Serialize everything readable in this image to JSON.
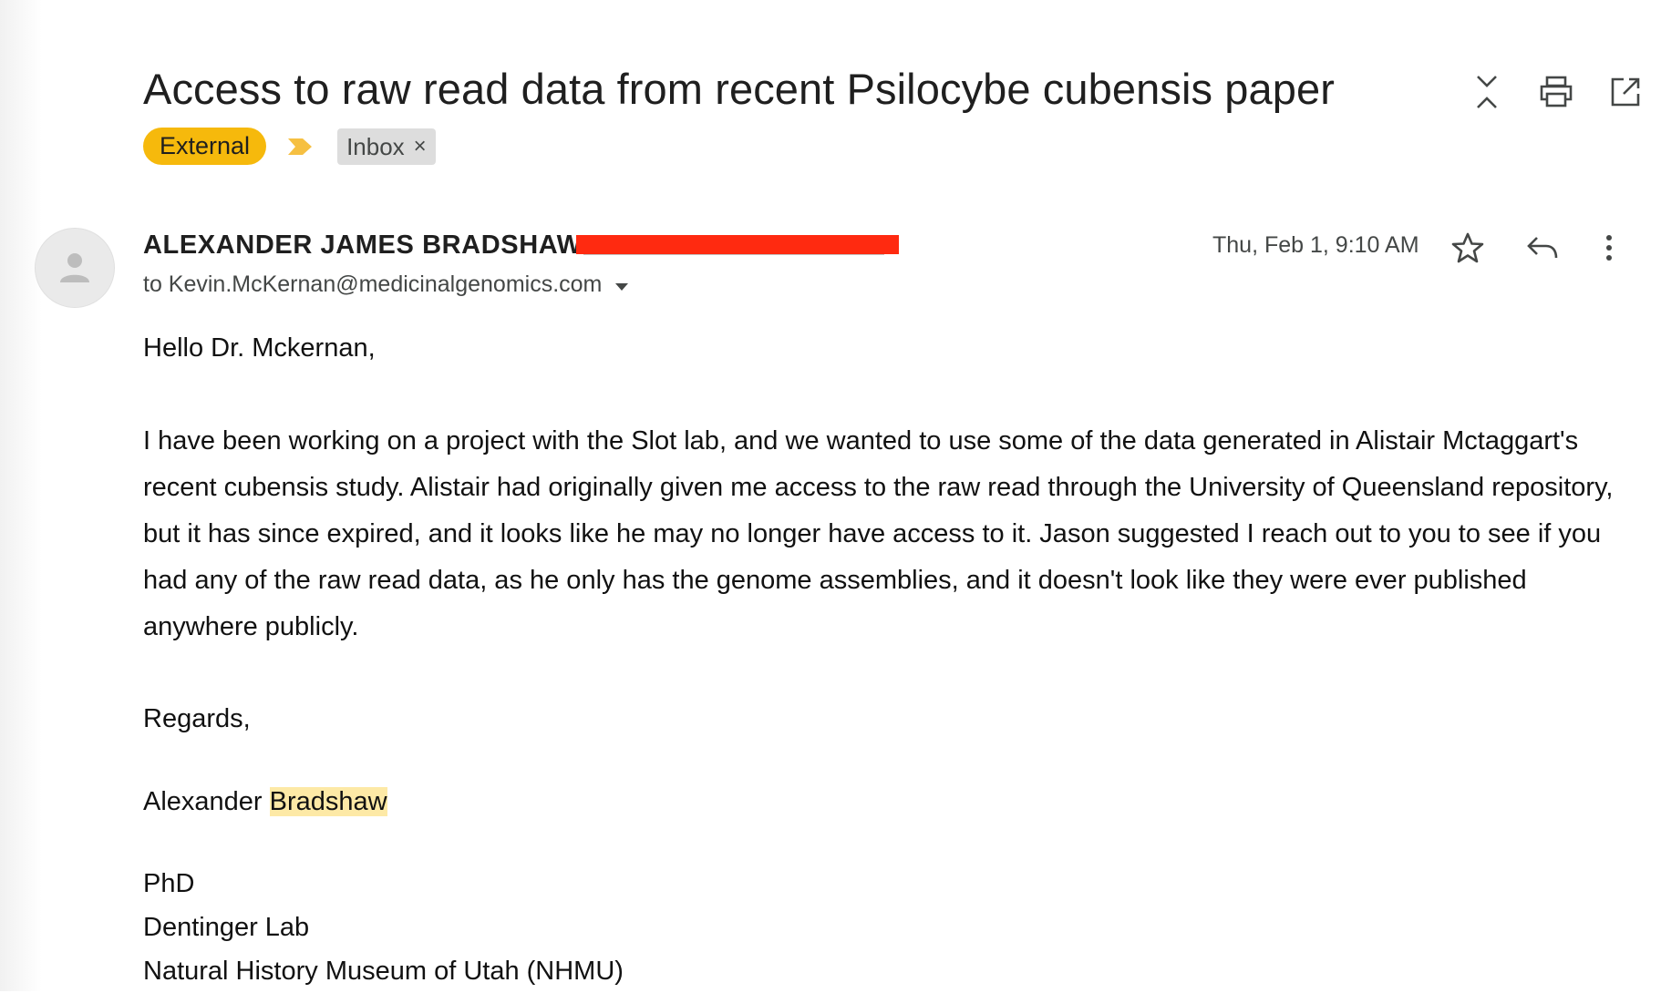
{
  "email": {
    "subject": "Access to raw read data from recent Psilocybe cubensis paper",
    "labels": {
      "external": "External",
      "inbox": "Inbox",
      "inbox_remove": "×"
    },
    "sender": {
      "name": "ALEXANDER JAMES BRADSHAW"
    },
    "recipient": "to Kevin.McKernan@medicinalgenomics.com",
    "date": "Thu, Feb 1, 9:10 AM",
    "body": {
      "greeting": "Hello Dr. Mckernan,",
      "paragraph": "I have been working on a project with the Slot lab, and we wanted to use some of the data generated in Alistair Mctaggart's recent cubensis study.  Alistair had originally given me access to the raw read through the University of Queensland repository, but it has since expired, and it looks like he may no longer have access to it. Jason suggested I reach out to you to see if you had any of the raw read data, as he only has the genome assemblies, and it doesn't look like they were ever published anywhere publicly.",
      "regards": "Regards,",
      "signature_first": "Alexander",
      "signature_last": "Bradshaw",
      "credentials": "PhD",
      "lab": "Dentinger Lab",
      "institution": "Natural History Museum of Utah (NHMU)"
    }
  },
  "icons": {
    "collapse": "unfold-less-icon",
    "print": "print-icon",
    "open_new_window": "open-in-new-icon",
    "star": "star-icon",
    "reply": "reply-icon",
    "more": "more-vert-icon",
    "avatar": "person-icon",
    "importance": "importance-marker-icon",
    "recipient_dropdown": "caret-down-icon"
  },
  "colors": {
    "external_label": "#f6b90c",
    "importance_marker": "#f6c042",
    "redaction": "#ff2a10",
    "signature_highlight": "#fde9a6"
  }
}
